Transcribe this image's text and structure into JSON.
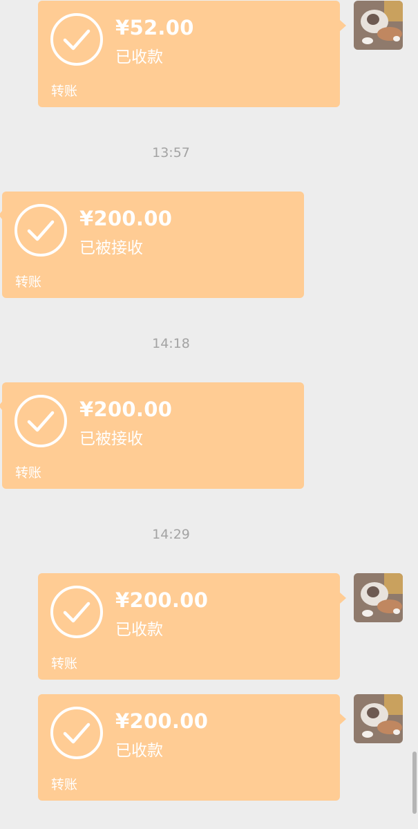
{
  "messages": [
    {
      "side": "right",
      "amount": "¥52.00",
      "status": "已收款",
      "label": "转账"
    },
    {
      "timestamp": "13:57"
    },
    {
      "side": "left",
      "amount": "¥200.00",
      "status": "已被接收",
      "label": "转账"
    },
    {
      "timestamp": "14:18"
    },
    {
      "side": "left",
      "amount": "¥200.00",
      "status": "已被接收",
      "label": "转账"
    },
    {
      "timestamp": "14:29"
    },
    {
      "side": "right",
      "amount": "¥200.00",
      "status": "已收款",
      "label": "转账"
    },
    {
      "side": "right",
      "amount": "¥200.00",
      "status": "已收款",
      "label": "转账"
    }
  ],
  "colors": {
    "background": "#ededed",
    "transfer_bubble": "#ffcc94",
    "timestamp_text": "#a3a3a3"
  },
  "icons": {
    "received": "check-circle-icon",
    "avatar": "cat-photo-avatar"
  }
}
